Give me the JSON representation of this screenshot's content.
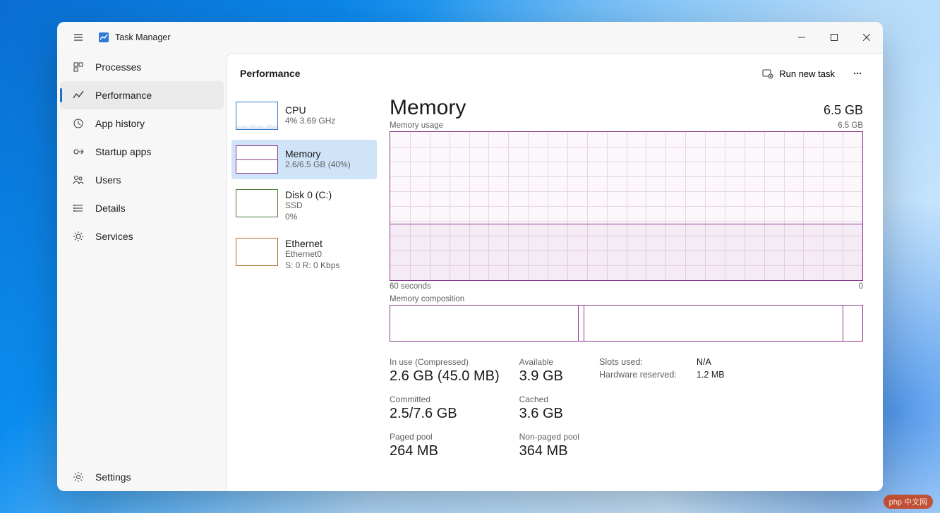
{
  "app": {
    "title": "Task Manager"
  },
  "sidebar": {
    "items": [
      {
        "label": "Processes"
      },
      {
        "label": "Performance"
      },
      {
        "label": "App history"
      },
      {
        "label": "Startup apps"
      },
      {
        "label": "Users"
      },
      {
        "label": "Details"
      },
      {
        "label": "Services"
      }
    ],
    "settings": "Settings"
  },
  "header": {
    "page_title": "Performance",
    "run_task": "Run new task"
  },
  "metrics": {
    "cpu": {
      "name": "CPU",
      "sub": "4%  3.69 GHz"
    },
    "memory": {
      "name": "Memory",
      "sub": "2.6/6.5 GB (40%)"
    },
    "disk": {
      "name": "Disk 0 (C:)",
      "sub": "SSD",
      "sub2": "0%"
    },
    "ethernet": {
      "name": "Ethernet",
      "sub": "Ethernet0",
      "sub2": "S: 0  R: 0 Kbps"
    }
  },
  "detail": {
    "title": "Memory",
    "total": "6.5 GB",
    "usage_label": "Memory usage",
    "usage_max": "6.5 GB",
    "x_left": "60 seconds",
    "x_right": "0",
    "composition_label": "Memory composition",
    "stats": {
      "in_use_label": "In use (Compressed)",
      "in_use_value": "2.6 GB (45.0 MB)",
      "available_label": "Available",
      "available_value": "3.9 GB",
      "committed_label": "Committed",
      "committed_value": "2.5/7.6 GB",
      "cached_label": "Cached",
      "cached_value": "3.6 GB",
      "paged_label": "Paged pool",
      "paged_value": "264 MB",
      "nonpaged_label": "Non-paged pool",
      "nonpaged_value": "364 MB"
    },
    "hw": {
      "slots_label": "Slots used:",
      "slots_value": "N/A",
      "reserved_label": "Hardware reserved:",
      "reserved_value": "1.2 MB"
    }
  },
  "watermark": "php 中文网",
  "chart_data": {
    "type": "area",
    "title": "Memory usage",
    "xlabel": "seconds ago",
    "ylabel": "GB",
    "x_range": [
      60,
      0
    ],
    "ylim": [
      0,
      6.5
    ],
    "series": [
      {
        "name": "Memory usage (GB)",
        "flat_value": 2.6
      }
    ],
    "composition_segments_pct": [
      40,
      1,
      55,
      4
    ]
  }
}
